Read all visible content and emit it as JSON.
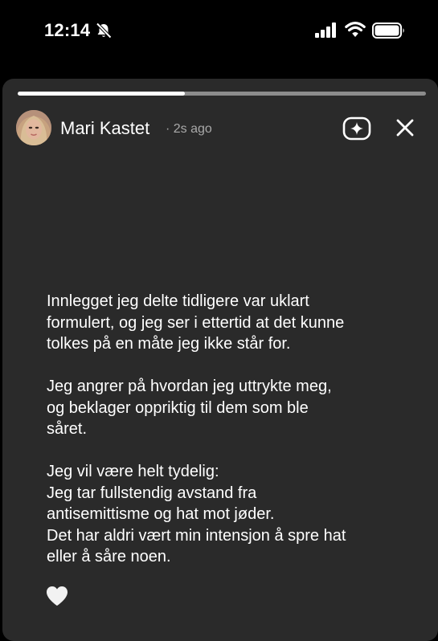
{
  "status_bar": {
    "time": "12:14",
    "icons": [
      "bell-slash-icon",
      "cellular-signal-icon",
      "wifi-icon",
      "battery-icon"
    ]
  },
  "story": {
    "progress": 0.41,
    "author": {
      "name": "Mari Kastet",
      "time_ago": "· 2s ago"
    },
    "actions": {
      "sparkle_icon": "sparkle-icon",
      "close_icon": "close-icon",
      "like_icon": "heart-icon"
    },
    "paragraphs": [
      "Innlegget jeg delte tidligere var uklart\nformulert, og jeg ser i ettertid at det kunne\ntolkes på en måte jeg ikke står for.",
      "Jeg angrer på hvordan jeg uttrykte meg,\nog beklager oppriktig til dem som ble\nsåret.",
      "Jeg vil være helt tydelig:\nJeg tar fullstendig avstand fra\nantisemittisme og hat mot jøder.\nDet har aldri vært min intensjon å spre hat\neller å såre noen."
    ]
  },
  "colors": {
    "background": "#000000",
    "sheet": "#2a2a2a",
    "text": "#ffffff",
    "muted": "#a9a9a9",
    "progress_track": "#8c8c8c",
    "like": "#f2f2f2"
  }
}
